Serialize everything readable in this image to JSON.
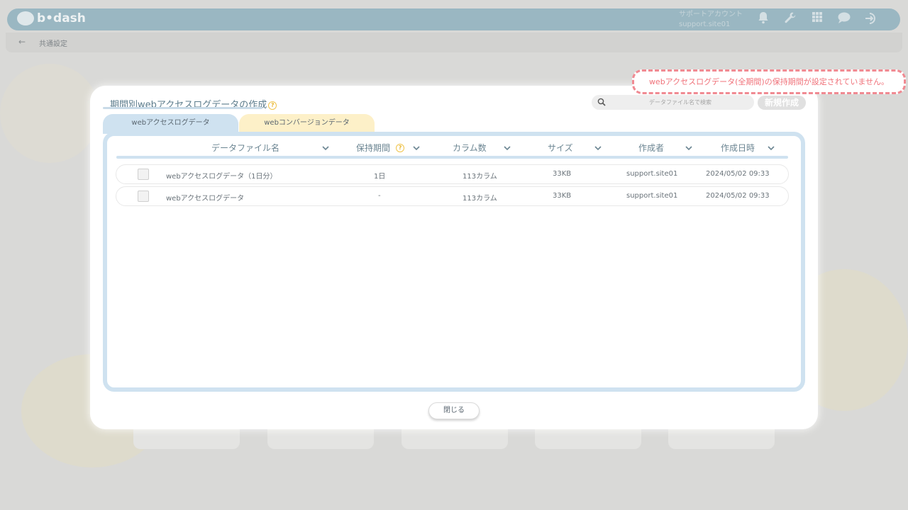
{
  "app": {
    "logo_text": "b•dash",
    "account_label": "サポートアカウント",
    "account_id": "support.site01",
    "top_icons": [
      "bell-icon",
      "wrench-icon",
      "grid-icon",
      "chat-icon",
      "logout-icon"
    ],
    "breadcrumb": "共通設定"
  },
  "modal": {
    "title": "期間別webアクセスログデータの作成",
    "search_placeholder": "データファイル名で検索",
    "new_button_label": "新規作成",
    "tabs": [
      {
        "label": "webアクセスログデータ",
        "active": true
      },
      {
        "label": "webコンバージョンデータ",
        "active": false
      }
    ],
    "columns": [
      "データファイル名",
      "保持期間",
      "カラム数",
      "サイズ",
      "作成者",
      "作成日時"
    ],
    "rows": [
      {
        "name": "webアクセスログデータ（1日分）",
        "period": "1日",
        "columns": "113カラム",
        "size": "33KB",
        "creator": "support.site01",
        "created": "2024/05/02 09:33"
      },
      {
        "name": "webアクセスログデータ",
        "period": "-",
        "columns": "113カラム",
        "size": "33KB",
        "creator": "support.site01",
        "created": "2024/05/02 09:33"
      }
    ],
    "close_label": "閉じる"
  },
  "toast": {
    "message": "webアクセスログデータ(全期間)の保持期間が設定されていません。"
  },
  "colors": {
    "accent_blue": "#cfe2f0",
    "accent_yellow": "#fdf0c8",
    "toast_red": "#f08a92",
    "topbar": "#9ab7c2"
  }
}
